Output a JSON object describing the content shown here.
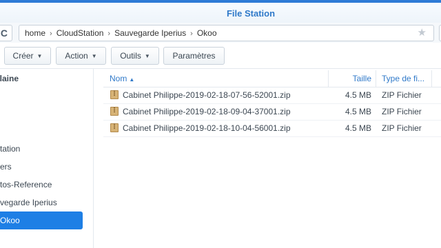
{
  "window": {
    "title": "File Station"
  },
  "path": {
    "segments": [
      "home",
      "CloudStation",
      "Sauvegarde Iperius",
      "Okoo"
    ],
    "separator": "›"
  },
  "toolbar": {
    "create_label": "Créer",
    "action_label": "Action",
    "tools_label": "Outils",
    "settings_label": "Paramètres"
  },
  "sidebar": {
    "heading": "rlaine",
    "items": [
      {
        "label": "tation"
      },
      {
        "label": "ers"
      },
      {
        "label": "tos-Reference"
      },
      {
        "label": "vegarde Iperius"
      },
      {
        "label": "Okoo",
        "active": true
      }
    ]
  },
  "table": {
    "columns": {
      "name": "Nom",
      "size": "Taille",
      "type": "Type de fi..."
    },
    "rows": [
      {
        "name": "Cabinet Philippe-2019-02-18-07-56-52001.zip",
        "size": "4.5 MB",
        "type": "ZIP Fichier"
      },
      {
        "name": "Cabinet Philippe-2019-02-18-09-04-37001.zip",
        "size": "4.5 MB",
        "type": "ZIP Fichier"
      },
      {
        "name": "Cabinet Philippe-2019-02-18-10-04-56001.zip",
        "size": "4.5 MB",
        "type": "ZIP Fichier"
      }
    ]
  },
  "icons": {
    "refresh": "refresh-icon",
    "favorite": "star-icon",
    "file": "zip-file-icon",
    "sort": "sort-ascending-icon"
  },
  "colors": {
    "accent": "#1e7fe5",
    "title": "#2f79c9",
    "top_strip": "#2e7bd6"
  }
}
